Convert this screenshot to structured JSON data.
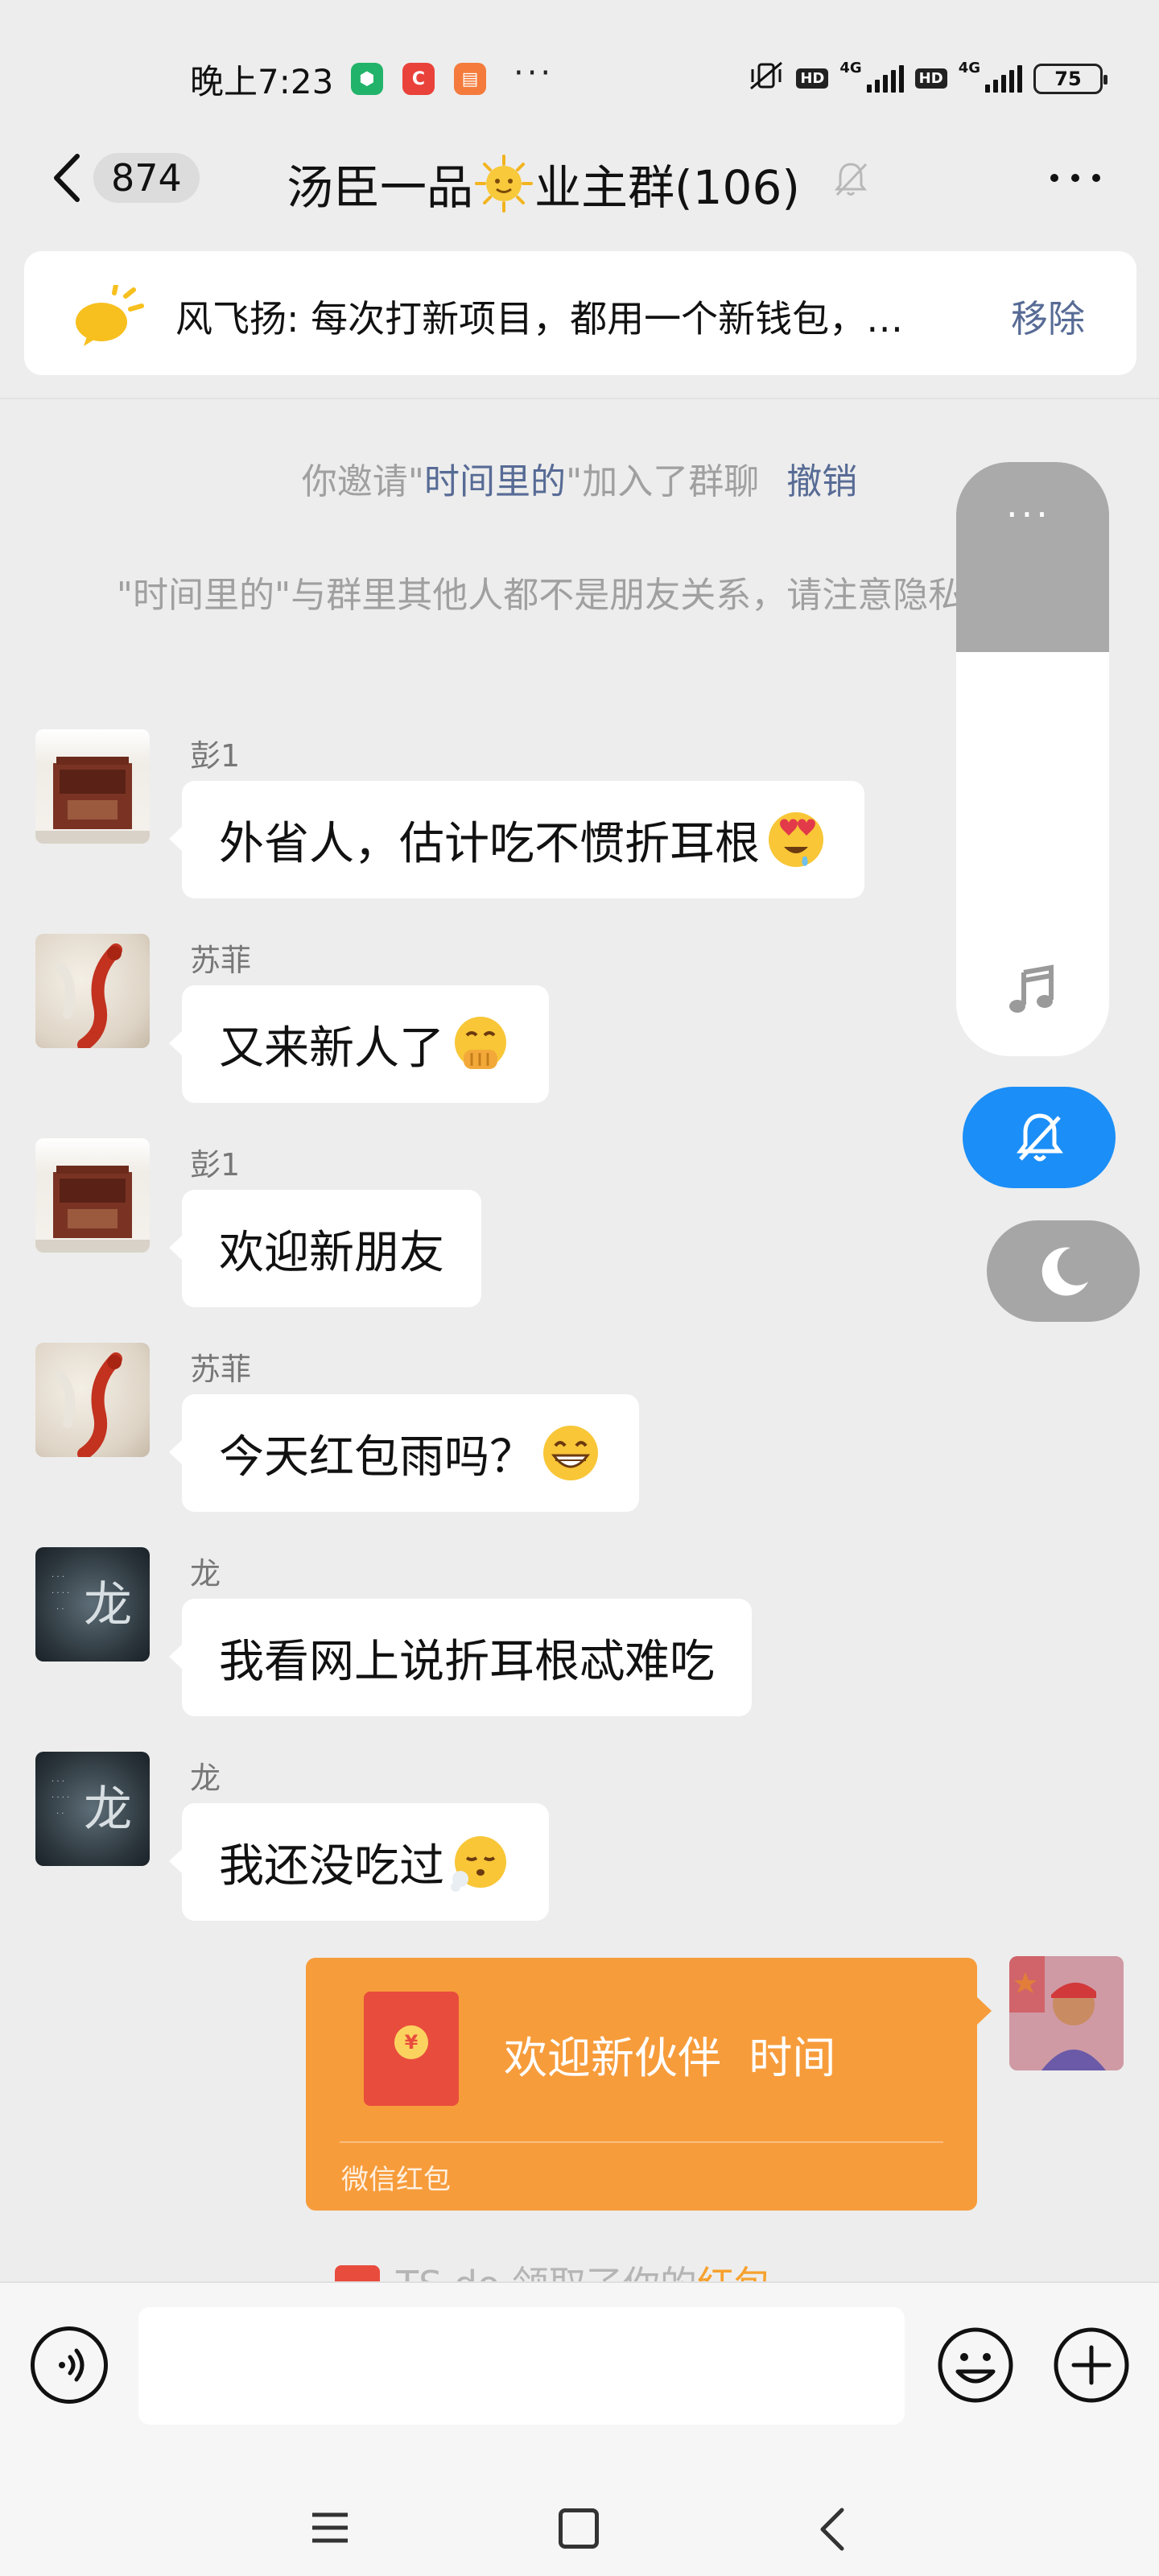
{
  "status_bar": {
    "time": "晚上7:23",
    "net_1": "4G",
    "net_2": "4G",
    "hd_1": "HD",
    "hd_2": "HD",
    "battery": "75",
    "dots": "···"
  },
  "header": {
    "unread_count": "874",
    "title_part1": "汤臣一品",
    "title_part2": "业主群(106)"
  },
  "pinned": {
    "text": "风飞扬: 每次打新项目，都用一个新钱包，…",
    "remove_label": "移除"
  },
  "system_notices": {
    "invite_prefix": "你邀请\"",
    "invite_name": "时间里的",
    "invite_suffix": "\"加入了群聊",
    "undo_label": "撤销",
    "warning": "\"时间里的\"与群里其他人都不是朋友关系，请注意隐私安全"
  },
  "messages": [
    {
      "sender": "彭1",
      "text": "外省人，估计吃不惯折耳根",
      "emoji": "heart-eyes"
    },
    {
      "sender": "苏菲",
      "text": "又来新人了",
      "emoji": "hand-over-mouth"
    },
    {
      "sender": "彭1",
      "text": "欢迎新朋友",
      "emoji": ""
    },
    {
      "sender": "苏菲",
      "text": "今天红包雨吗？",
      "emoji": "grin"
    },
    {
      "sender": "龙",
      "text": "我看网上说折耳根忒难吃",
      "emoji": ""
    },
    {
      "sender": "龙",
      "text": "我还没吃过",
      "emoji": "sigh"
    }
  ],
  "red_packet": {
    "title": "欢迎新伙伴  时间",
    "label": "微信红包",
    "coin": "¥"
  },
  "peek_notice": {
    "text": "TS do  领取了你的",
    "highlight": "红包"
  },
  "input": {
    "placeholder": "",
    "value": ""
  },
  "colors": {
    "accent_blue": "#1b8ef7",
    "link_blue": "#576b95",
    "red_packet": "#f79c3b",
    "bg": "#ededed"
  },
  "floating_panel": {
    "dots": "···"
  }
}
